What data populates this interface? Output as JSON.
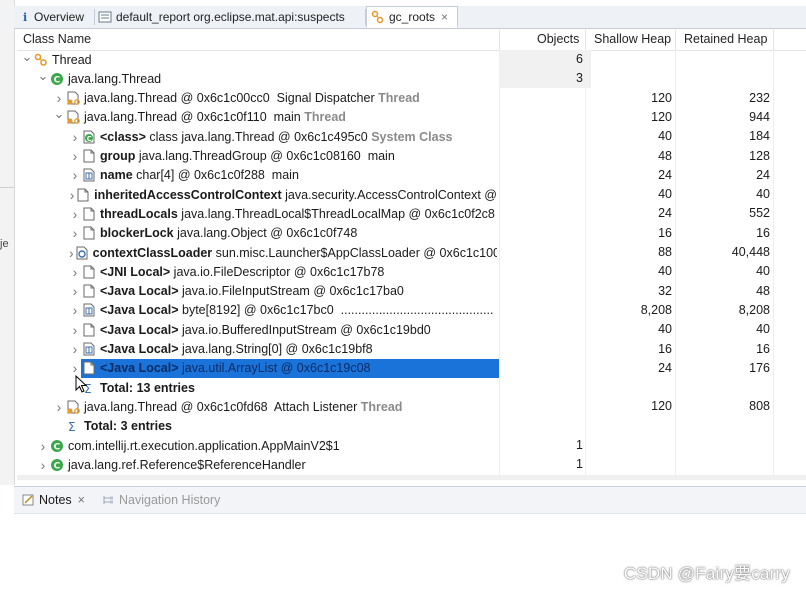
{
  "tabs": [
    {
      "label": "Overview",
      "icon": "info-icon",
      "active": false
    },
    {
      "label": "default_report  org.eclipse.mat.api:suspects",
      "icon": "report-icon",
      "active": false
    },
    {
      "label": "gc_roots",
      "icon": "gc-roots-icon",
      "active": true,
      "close": "×"
    }
  ],
  "left_pane": {
    "fragment": "je"
  },
  "table": {
    "headers": {
      "class_name": "Class Name",
      "objects": "Objects",
      "shallow_heap": "Shallow Heap",
      "retained_heap": "Retained Heap"
    },
    "rows": [
      {
        "indent": 0,
        "arrow": "down",
        "icon": "gc-group-icon",
        "segments": [
          {
            "t": "Thread",
            "s": ""
          }
        ],
        "objects": "6",
        "shallow": "",
        "retained": "",
        "obj_bg": true
      },
      {
        "indent": 1,
        "arrow": "down",
        "icon": "class-icon",
        "segments": [
          {
            "t": "java.lang.Thread",
            "s": ""
          }
        ],
        "objects": "3",
        "shallow": "",
        "retained": "",
        "obj_bg": true
      },
      {
        "indent": 2,
        "arrow": "right",
        "icon": "thread-object-icon",
        "segments": [
          {
            "t": "java.lang.Thread @ 0x6c1c00cc0  Signal Dispatcher ",
            "s": ""
          },
          {
            "t": "Thread",
            "s": "tail"
          }
        ],
        "objects": "",
        "shallow": "120",
        "retained": "232"
      },
      {
        "indent": 2,
        "arrow": "down",
        "icon": "thread-object-icon",
        "segments": [
          {
            "t": "java.lang.Thread @ 0x6c1c0f110  main ",
            "s": ""
          },
          {
            "t": "Thread",
            "s": "tail"
          }
        ],
        "objects": "",
        "shallow": "120",
        "retained": "944"
      },
      {
        "indent": 3,
        "arrow": "right",
        "icon": "class-ref-icon",
        "segments": [
          {
            "t": "<class>",
            "s": "b"
          },
          {
            "t": " class java.lang.Thread @ 0x6c1c495c0 ",
            "s": ""
          },
          {
            "t": "System Class",
            "s": "tail"
          }
        ],
        "objects": "",
        "shallow": "40",
        "retained": "184"
      },
      {
        "indent": 3,
        "arrow": "right",
        "icon": "object-icon",
        "segments": [
          {
            "t": "group",
            "s": "b"
          },
          {
            "t": " java.lang.ThreadGroup @ 0x6c1c08160  main",
            "s": ""
          }
        ],
        "objects": "",
        "shallow": "48",
        "retained": "128"
      },
      {
        "indent": 3,
        "arrow": "right",
        "icon": "array-icon",
        "segments": [
          {
            "t": "name",
            "s": "b"
          },
          {
            "t": " char[4] @ 0x6c1c0f288  main",
            "s": ""
          }
        ],
        "objects": "",
        "shallow": "24",
        "retained": "24"
      },
      {
        "indent": 3,
        "arrow": "right",
        "icon": "object-icon",
        "segments": [
          {
            "t": "inheritedAccessControlContext",
            "s": "b"
          },
          {
            "t": " java.security.AccessControlContext @",
            "s": ""
          }
        ],
        "objects": "",
        "shallow": "40",
        "retained": "40"
      },
      {
        "indent": 3,
        "arrow": "right",
        "icon": "object-icon",
        "segments": [
          {
            "t": "threadLocals",
            "s": "b"
          },
          {
            "t": " java.lang.ThreadLocal$ThreadLocalMap @ 0x6c1c0f2c8",
            "s": ""
          }
        ],
        "objects": "",
        "shallow": "24",
        "retained": "552"
      },
      {
        "indent": 3,
        "arrow": "right",
        "icon": "object-icon",
        "segments": [
          {
            "t": "blockerLock",
            "s": "b"
          },
          {
            "t": " java.lang.Object @ 0x6c1c0f748",
            "s": ""
          }
        ],
        "objects": "",
        "shallow": "16",
        "retained": "16"
      },
      {
        "indent": 3,
        "arrow": "right",
        "icon": "loader-icon",
        "segments": [
          {
            "t": "contextClassLoader",
            "s": "b"
          },
          {
            "t": " sun.misc.Launcher$AppClassLoader @ 0x6c1c100(",
            "s": ""
          }
        ],
        "objects": "",
        "shallow": "88",
        "retained": "40,448"
      },
      {
        "indent": 3,
        "arrow": "right",
        "icon": "object-icon",
        "segments": [
          {
            "t": "<JNI Local>",
            "s": "b"
          },
          {
            "t": " java.io.FileDescriptor @ 0x6c1c17b78",
            "s": ""
          }
        ],
        "objects": "",
        "shallow": "40",
        "retained": "40"
      },
      {
        "indent": 3,
        "arrow": "right",
        "icon": "object-icon",
        "segments": [
          {
            "t": "<Java Local>",
            "s": "b"
          },
          {
            "t": " java.io.FileInputStream @ 0x6c1c17ba0",
            "s": ""
          }
        ],
        "objects": "",
        "shallow": "32",
        "retained": "48"
      },
      {
        "indent": 3,
        "arrow": "right",
        "icon": "array-icon",
        "segments": [
          {
            "t": "<Java Local>",
            "s": "b"
          },
          {
            "t": " byte[8192] @ 0x6c1c17bc0  ............................................",
            "s": ""
          }
        ],
        "objects": "",
        "shallow": "8,208",
        "retained": "8,208"
      },
      {
        "indent": 3,
        "arrow": "right",
        "icon": "object-icon",
        "segments": [
          {
            "t": "<Java Local>",
            "s": "b"
          },
          {
            "t": " java.io.BufferedInputStream @ 0x6c1c19bd0",
            "s": ""
          }
        ],
        "objects": "",
        "shallow": "40",
        "retained": "40"
      },
      {
        "indent": 3,
        "arrow": "right",
        "icon": "array-icon",
        "segments": [
          {
            "t": "<Java Local>",
            "s": "b"
          },
          {
            "t": " java.lang.String[0] @ 0x6c1c19bf8",
            "s": ""
          }
        ],
        "objects": "",
        "shallow": "16",
        "retained": "16"
      },
      {
        "indent": 3,
        "arrow": "right",
        "icon": "object-icon",
        "selected": true,
        "segments": [
          {
            "t": "<Java Local>",
            "s": "b"
          },
          {
            "t": " java.util.ArrayList @ 0x6c1c19c08",
            "s": ""
          }
        ],
        "objects": "",
        "shallow": "24",
        "retained": "176"
      },
      {
        "indent": 3,
        "arrow": "",
        "icon": "sum-icon",
        "total": true,
        "segments": [
          {
            "t": "Total: 13 entries",
            "s": "b"
          }
        ],
        "objects": "",
        "shallow": "",
        "retained": ""
      },
      {
        "indent": 2,
        "arrow": "right",
        "icon": "thread-object-icon",
        "segments": [
          {
            "t": "java.lang.Thread @ 0x6c1c0fd68  Attach Listener ",
            "s": ""
          },
          {
            "t": "Thread",
            "s": "tail"
          }
        ],
        "objects": "",
        "shallow": "120",
        "retained": "808"
      },
      {
        "indent": 2,
        "arrow": "",
        "icon": "sum-icon",
        "total": true,
        "segments": [
          {
            "t": "Total: 3 entries",
            "s": "b"
          }
        ],
        "objects": "",
        "shallow": "",
        "retained": ""
      },
      {
        "indent": 1,
        "arrow": "right",
        "icon": "class-icon",
        "segments": [
          {
            "t": "com.intellij.rt.execution.application.AppMainV2$1",
            "s": ""
          }
        ],
        "objects": "1",
        "shallow": "",
        "retained": ""
      },
      {
        "indent": 1,
        "arrow": "right",
        "icon": "class-icon",
        "segments": [
          {
            "t": "java.lang.ref.Reference$ReferenceHandler",
            "s": ""
          }
        ],
        "objects": "1",
        "shallow": "",
        "retained": ""
      }
    ]
  },
  "bottom_tabs": [
    {
      "label": "Notes",
      "icon": "notes-icon",
      "close": "×",
      "active": true
    },
    {
      "label": "Navigation History",
      "icon": "navigation-history-icon",
      "active": false
    }
  ],
  "watermark": "CSDN @Fairy要carry",
  "colors": {
    "selection": "#1a73d9",
    "class_green": "#3aa84a",
    "folder_orange": "#e59a2b",
    "tail_gray": "#8a8a8a"
  }
}
